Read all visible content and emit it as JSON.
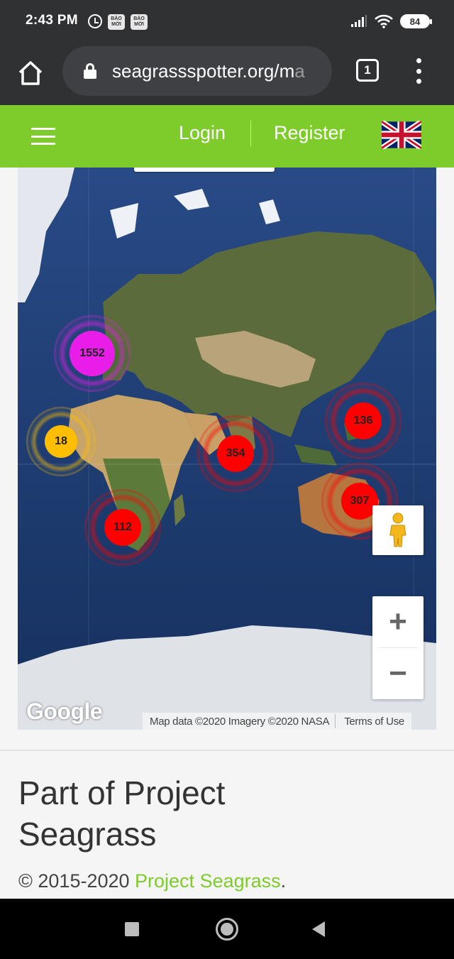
{
  "status_bar": {
    "time": "2:43 PM",
    "app_badge_1": "BÁO MỚI",
    "app_badge_2": "BÁO MỚI",
    "battery": "84"
  },
  "browser": {
    "url_main": "seagrassspotter.org/m",
    "url_faded": "a",
    "tab_count": "1"
  },
  "header": {
    "login": "Login",
    "register": "Register",
    "language_icon": "uk-flag-icon"
  },
  "map": {
    "clusters": [
      {
        "id": "europe",
        "count": "1552",
        "color": "#e81ee8"
      },
      {
        "id": "west-africa",
        "count": "18",
        "color": "#ffbf00"
      },
      {
        "id": "indian-ocean",
        "count": "354",
        "color": "#ff0000"
      },
      {
        "id": "west-pacific",
        "count": "136",
        "color": "#ff0000"
      },
      {
        "id": "australia",
        "count": "307",
        "color": "#ff0000"
      },
      {
        "id": "south-africa",
        "count": "112",
        "color": "#ff0000"
      }
    ],
    "zoom_in": "+",
    "zoom_out": "−",
    "google": "Google",
    "attribution": "Map data ©2020 Imagery ©2020 NASA",
    "terms": "Terms of Use"
  },
  "footer": {
    "title": "Part of Project Seagrass",
    "copyright_prefix": "© 2015-2020 ",
    "copyright_link": "Project Seagrass",
    "copyright_suffix": "."
  },
  "colors": {
    "brand_green": "#7ecb2c",
    "chrome_dark": "#2f3133"
  }
}
